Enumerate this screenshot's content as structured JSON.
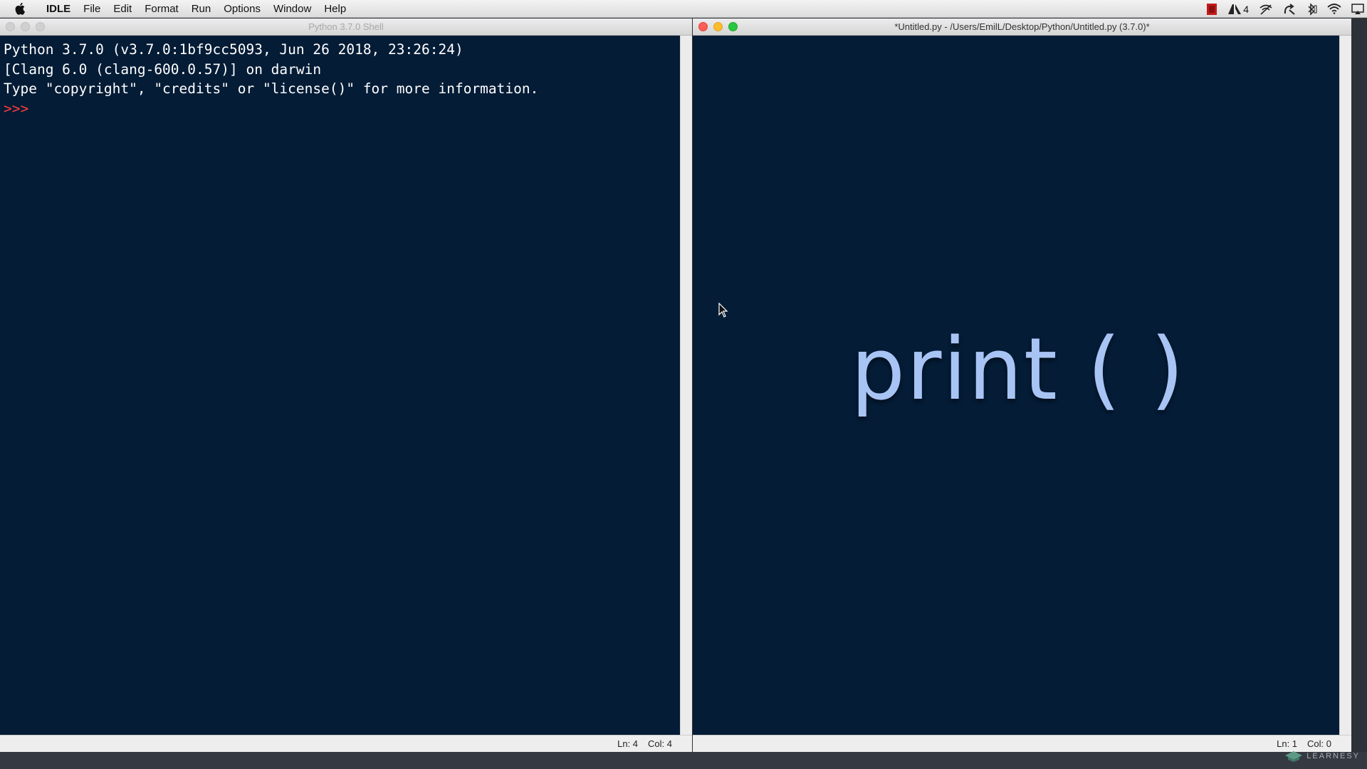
{
  "menubar": {
    "app": "IDLE",
    "items": [
      "File",
      "Edit",
      "Format",
      "Run",
      "Options",
      "Window",
      "Help"
    ],
    "status_count": "4"
  },
  "shell_window": {
    "title": "Python 3.7.0 Shell",
    "lines": [
      "Python 3.7.0 (v3.7.0:1bf9cc5093, Jun 26 2018, 23:26:24)",
      "[Clang 6.0 (clang-600.0.57)] on darwin",
      "Type \"copyright\", \"credits\" or \"license()\" for more information."
    ],
    "prompt": ">>>",
    "status": {
      "ln": "Ln: 4",
      "col": "Col: 4"
    }
  },
  "editor_window": {
    "title": "*Untitled.py - /Users/EmilL/Desktop/Python/Untitled.py (3.7.0)*",
    "overlay_text": "print ( )",
    "status": {
      "ln": "Ln: 1",
      "col": "Col: 0"
    }
  },
  "watermark": {
    "text": "LEARNESY"
  },
  "colors": {
    "editor_bg": "#041c36",
    "prompt": "#ff3b3b",
    "overlay_text": "#a8c4f4"
  },
  "icons": [
    "apple-icon",
    "adobe-icon",
    "wireless-icon",
    "sync-icon",
    "bluetooth-icon",
    "wifi-icon",
    "airplay-icon"
  ]
}
